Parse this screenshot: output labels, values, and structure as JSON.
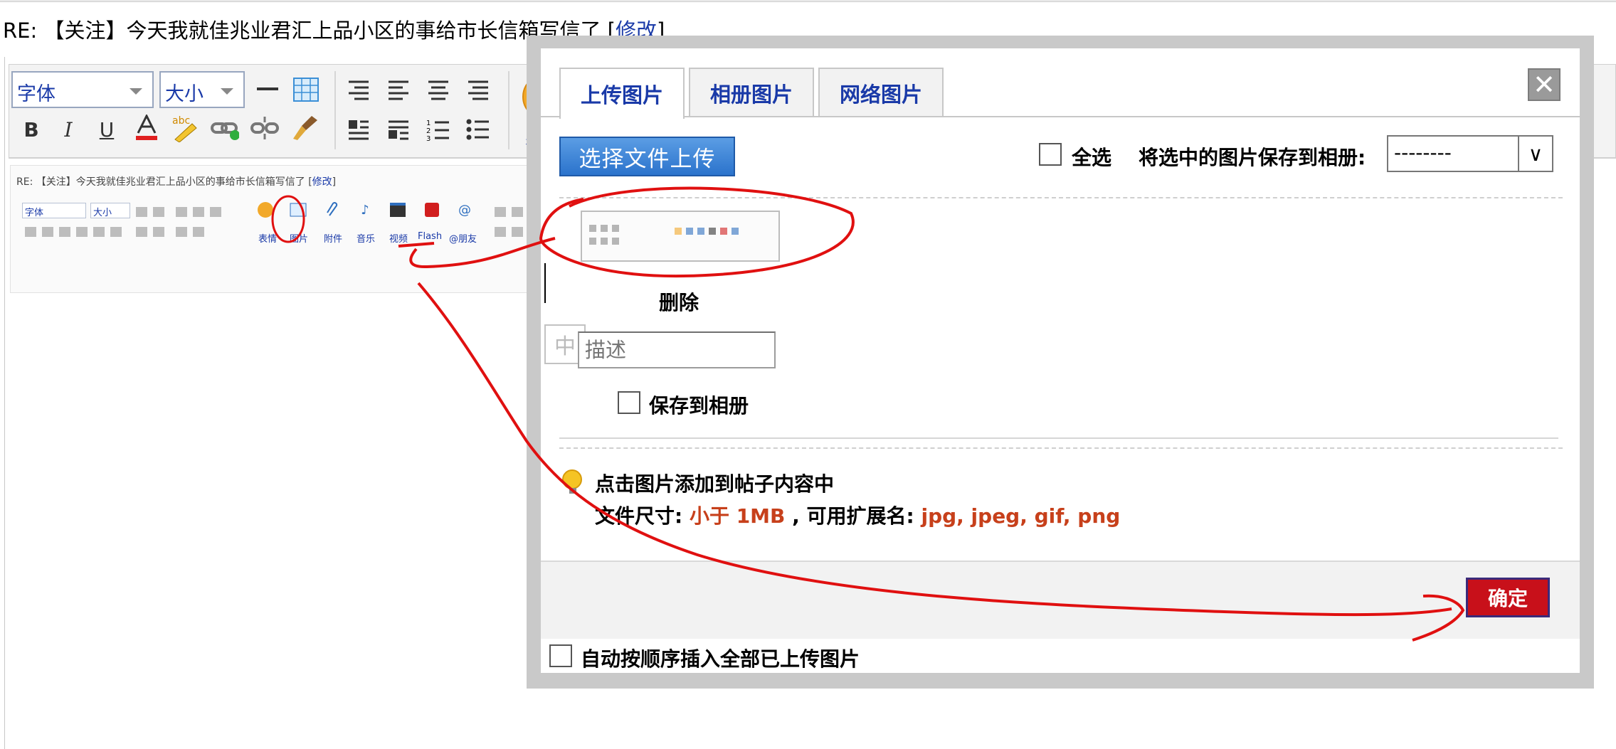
{
  "page": {
    "title_prefix": "RE: 【关注】今天我就佳兆业君汇上品小区的事给市长信箱写信了 [",
    "title_link": "修改",
    "title_suffix": "]"
  },
  "toolbar": {
    "font_select": "字体",
    "size_select": "大小",
    "emoji_label": "表"
  },
  "mini_editor": {
    "title_prefix": "RE: 【关注】今天我就佳兆业君汇上品小区的事给市长信箱写信了 [",
    "title_link": "修改",
    "title_suffix": "]",
    "font_select": "字体",
    "size_select": "大小",
    "labels": [
      "表情",
      "图片",
      "附件",
      "音乐",
      "视频",
      "Flash",
      "@朋友"
    ]
  },
  "dialog": {
    "tabs": [
      {
        "label": "上传图片",
        "active": true
      },
      {
        "label": "相册图片",
        "active": false
      },
      {
        "label": "网络图片",
        "active": false
      }
    ],
    "close_symbol": "✕",
    "upload_button": "选择文件上传",
    "select_all_label": "全选",
    "save_to_album_label": "将选中的图片保存到相册:",
    "album_select_value": "--------",
    "album_select_arrow": "∨",
    "delete_label": "删除",
    "ime_indicator": "中",
    "description_placeholder": "描述",
    "save_to_album_item_label": "保存到相册",
    "hint_line1": "点击图片添加到帖子内容中",
    "hint_size_label": "文件尺寸: ",
    "hint_size_value": "小于 1MB",
    "hint_ext_label": " , 可用扩展名: ",
    "hint_ext_value": "jpg, jpeg, gif, png",
    "ok_button": "确定",
    "auto_insert_label": "自动按顺序插入全部已上传图片"
  },
  "colors": {
    "link_blue": "#1a3aa8",
    "upload_blue": "#2b73cc",
    "ok_red": "#c8101a",
    "hint_red": "#c7401b",
    "annotation_red": "#e01010"
  }
}
